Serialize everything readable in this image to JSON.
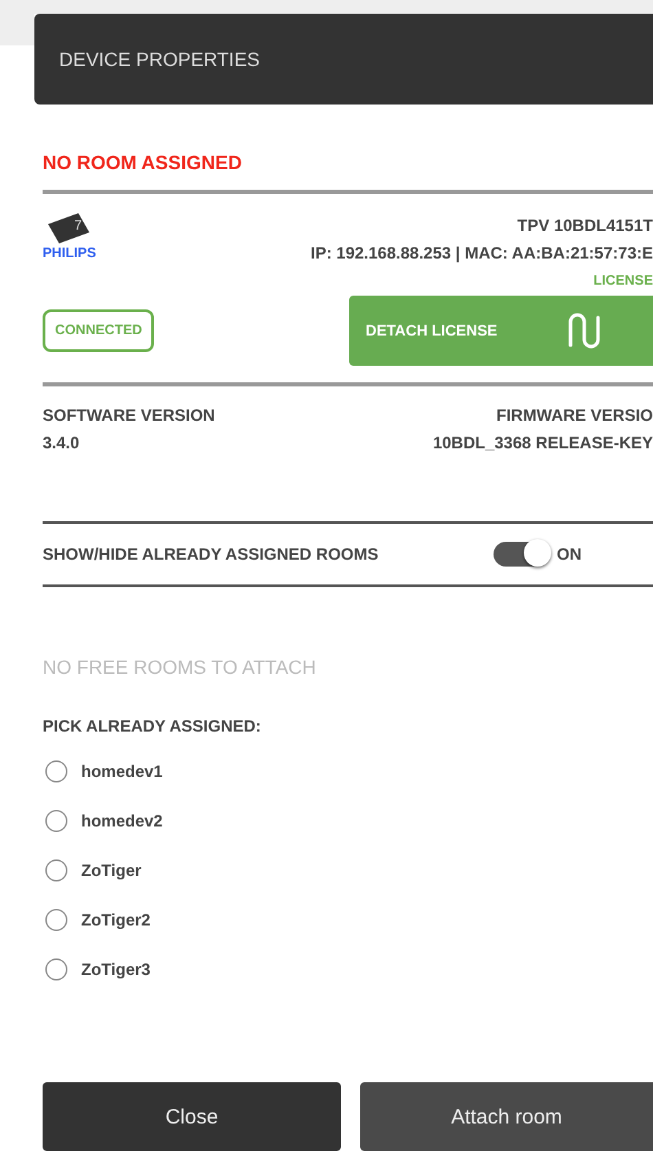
{
  "dialog": {
    "title": "DEVICE PROPERTIES"
  },
  "room_status": "NO ROOM ASSIGNED",
  "device": {
    "brand": "PHILIPS",
    "badge": "7",
    "model": "TPV 10BDL4151T",
    "network": "IP: 192.168.88.253 | MAC: AA:BA:21:57:73:E",
    "license": "LICENSE"
  },
  "connection": "CONNECTED",
  "detach_button": "DETACH LICENSE",
  "versions": [
    {
      "label": "SOFTWARE VERSION",
      "value": "3.4.0"
    },
    {
      "label": "FIRMWARE VERSIO",
      "value": "10BDL_3368 RELEASE-KEY"
    }
  ],
  "toggle": {
    "label": "SHOW/HIDE ALREADY ASSIGNED ROOMS",
    "on": true,
    "state": "ON"
  },
  "no_free_rooms": "NO FREE ROOMS TO ATTACH",
  "pick_label": "PICK ALREADY ASSIGNED:",
  "rooms": [
    {
      "name": "homedev1",
      "selected": false
    },
    {
      "name": "homedev2",
      "selected": false
    },
    {
      "name": "ZoTiger",
      "selected": false
    },
    {
      "name": "ZoTiger2",
      "selected": false
    },
    {
      "name": "ZoTiger3",
      "selected": false
    }
  ],
  "buttons": [
    "Close",
    "Attach room"
  ]
}
